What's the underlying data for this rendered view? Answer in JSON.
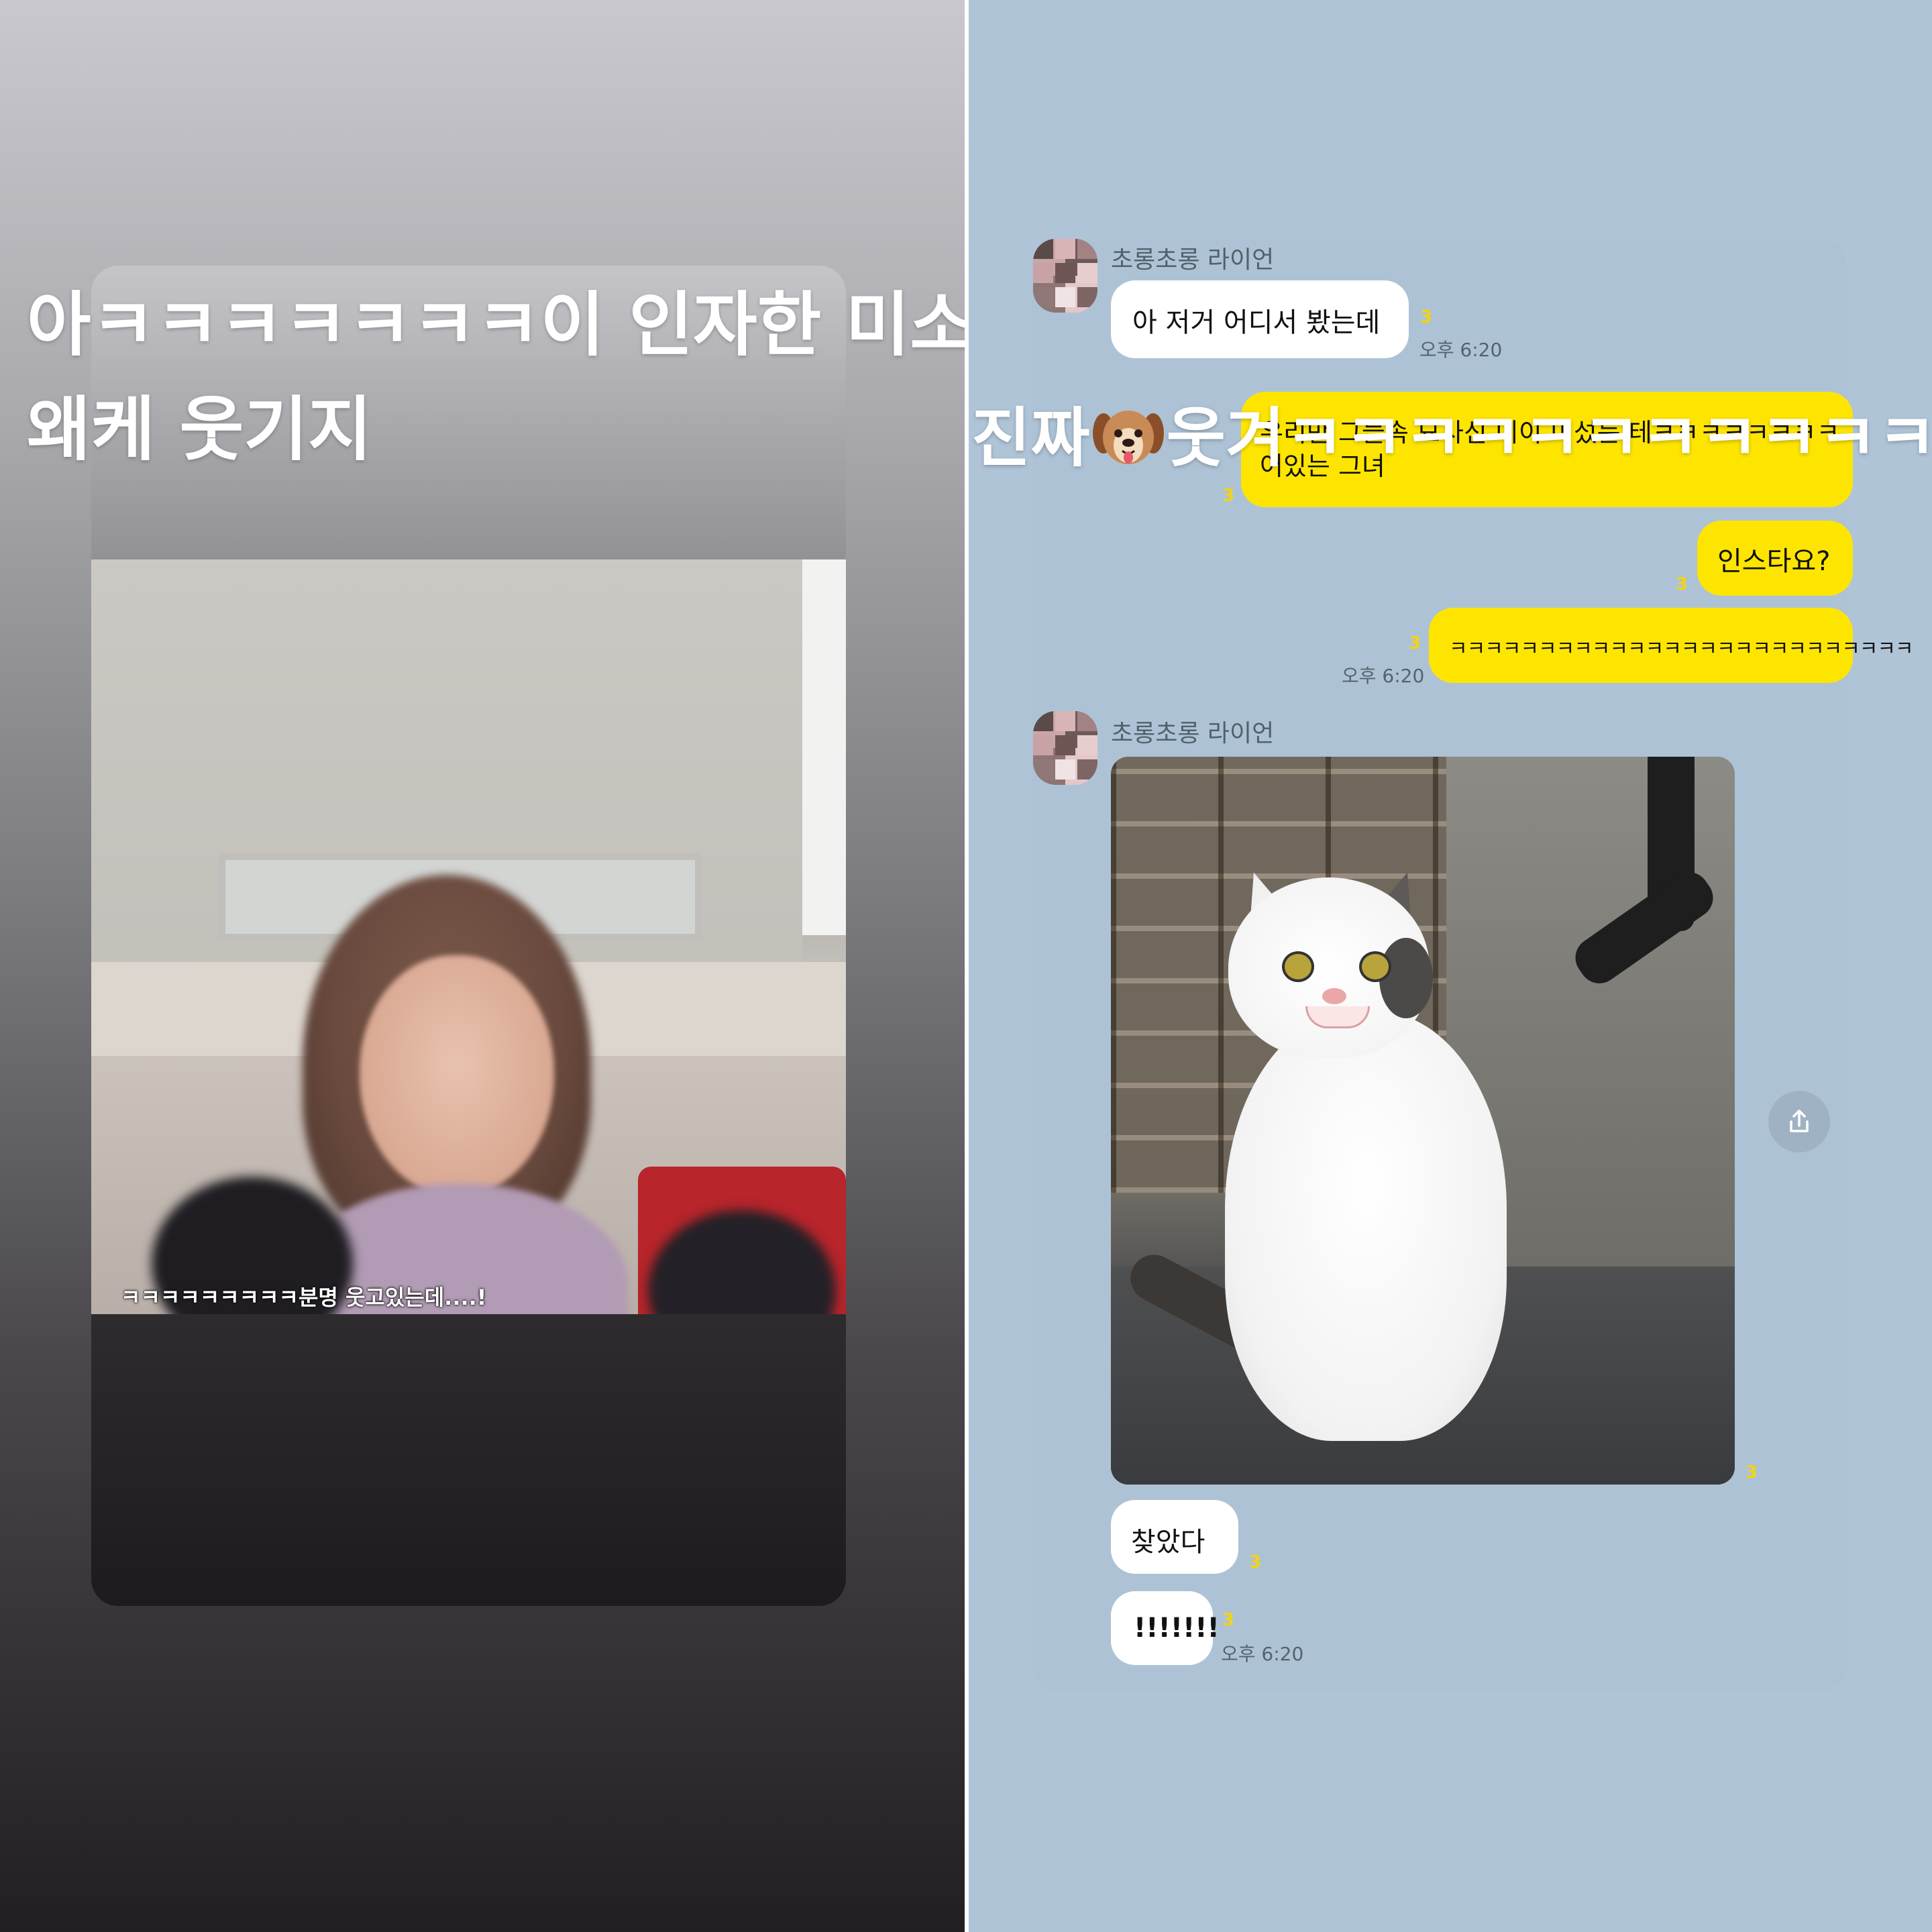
{
  "left_story": {
    "overlay_line1": "아ㅋㅋㅋㅋㅋㅋㅋ이 인자한 미소",
    "overlay_line2": "왜케 웃기지",
    "photo_caption": "ㅋㅋㅋㅋㅋㅋㅋㅋㅋ분명 웃고있는데....!"
  },
  "right_story": {
    "overlay_text_before": "진짜",
    "overlay_emoji": "dog-face-icon",
    "overlay_text_after": "웃겨ㅋㅋㅋㅋㅋㅋㅋㅋㅋㅋㅋㅋ",
    "chat": {
      "sender_name_1": "초롱초롱 라이언",
      "msg_1": "아 저거 어디서 봤는데",
      "msg_1_read": "3",
      "msg_1_time": "오후 6:20",
      "my_msg_1_line1": "우리만 그늘속 묘사신 미이 미섰는 테ㅋㅋㅋㅋㅋㅋㅋㅋ",
      "my_msg_1_line2": "어있는 그녀",
      "my_msg_1_read": "3",
      "my_msg_2": "인스타요?",
      "my_msg_2_read": "3",
      "my_msg_3": "ㅋㅋㅋㅋㅋㅋㅋㅋㅋㅋㅋㅋㅋㅋㅋㅋㅋㅋㅋㅋㅋㅋㅋㅋㅋㅋ",
      "my_msg_3_read": "3",
      "my_msg_3_time": "오후 6:20",
      "sender_name_2": "초롱초롱 라이언",
      "photo_read": "3",
      "msg_2": "찾았다",
      "msg_2_read": "3",
      "msg_3": "!!!!!!!",
      "msg_3_read": "3",
      "msg_3_time": "오후 6:20",
      "share_icon": "share-icon"
    }
  },
  "colors": {
    "chat_background": "#b0c4d8",
    "my_bubble": "#fee500",
    "their_bubble": "#ffffff",
    "read_count": "#f4d313"
  }
}
